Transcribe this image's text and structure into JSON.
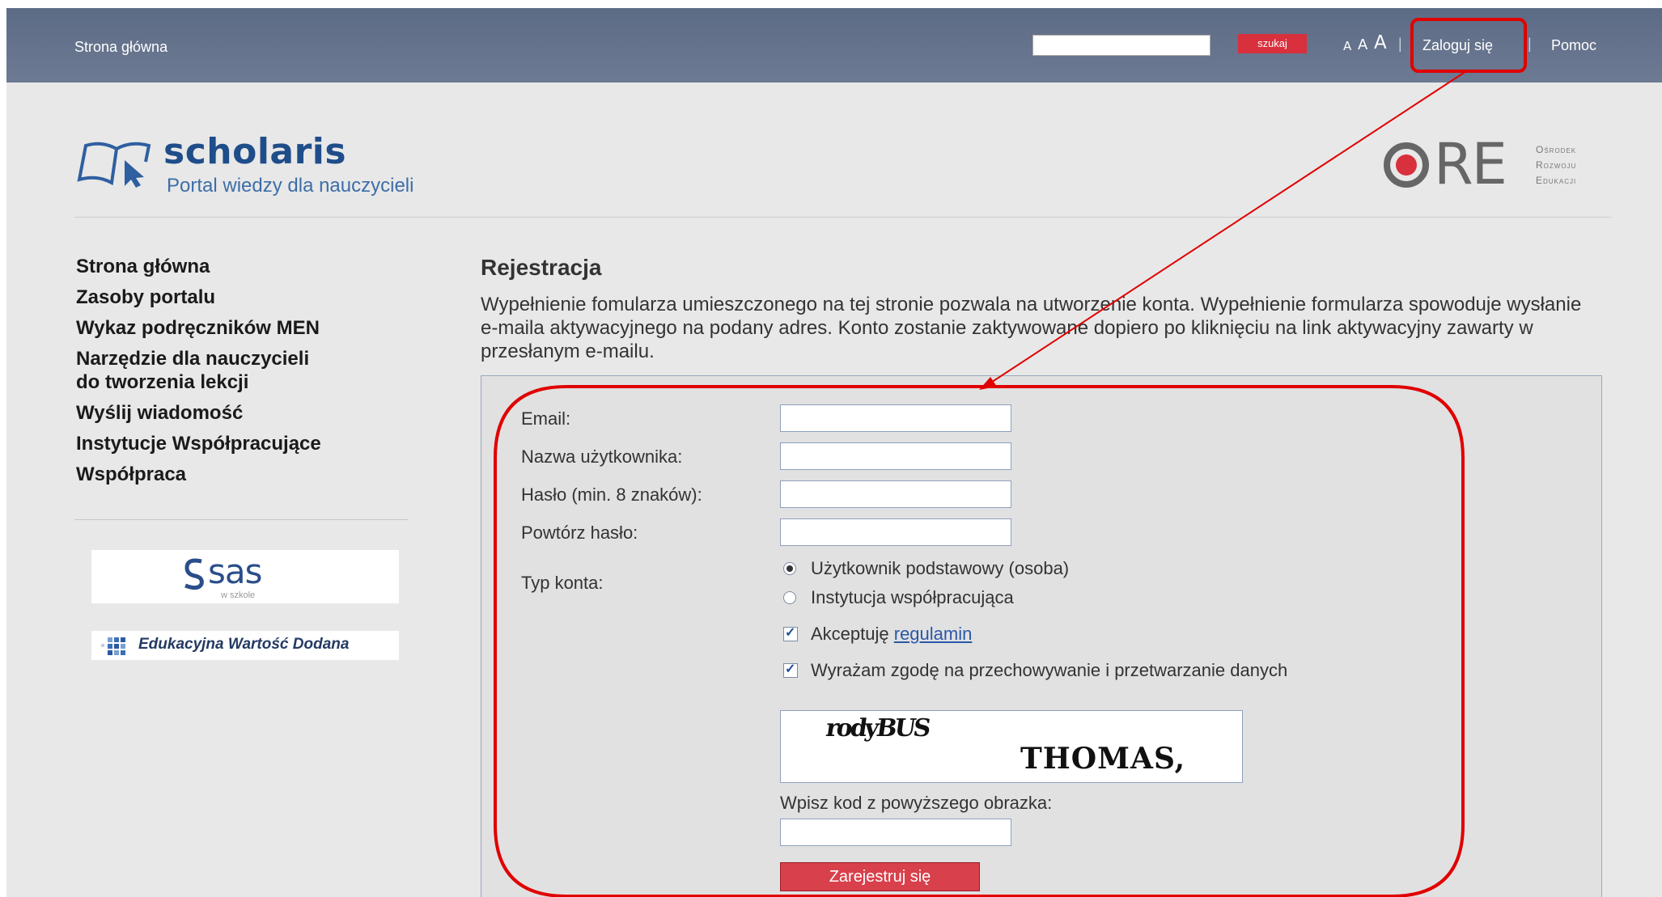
{
  "topbar": {
    "home": "Strona główna",
    "search_placeholder": "",
    "search_button": "szukaj",
    "font_small": "A",
    "font_medium": "A",
    "font_large": "A",
    "separator": "|",
    "login": "Zaloguj się",
    "help": "Pomoc"
  },
  "logo": {
    "name": "scholaris",
    "tagline": "Portal wiedzy dla nauczycieli"
  },
  "ore": {
    "mark": "RE",
    "line1": "Ośrodek",
    "line2": "Rozwoju",
    "line3": "Edukacji"
  },
  "sidebar": {
    "items": [
      {
        "label": "Strona główna"
      },
      {
        "label": "Zasoby portalu"
      },
      {
        "label": "Wykaz podręczników MEN"
      },
      {
        "label": "Narzędzie dla nauczycieli"
      },
      {
        "label": "do tworzenia lekcji"
      },
      {
        "label": "Wyślij wiadomość"
      },
      {
        "label": "Instytucje Współpracujące"
      },
      {
        "label": "Współpraca"
      }
    ],
    "sas": {
      "name": "sas",
      "sub": "w szkole"
    },
    "ewd": "Edukacyjna Wartość Dodana"
  },
  "main": {
    "title": "Rejestracja",
    "intro": "Wypełnienie fomularza umieszczonego na tej stronie pozwala na utworzenie konta. Wypełnienie formularza spowoduje wysłanie e-maila aktywacyjnego na podany adres. Konto zostanie zaktywowane dopiero po kliknięciu na link aktywacyjny zawarty w przesłanym e-mailu."
  },
  "form": {
    "email_label": "Email:",
    "email_value": "",
    "username_label": "Nazwa użytkownika:",
    "username_value": "",
    "password_label": "Hasło (min. 8 znaków):",
    "password_value": "",
    "repeat_label": "Powtórz hasło:",
    "repeat_value": "",
    "account_type_label": "Typ konta:",
    "account_types": [
      {
        "label": "Użytkownik podstawowy (osoba)",
        "selected": true
      },
      {
        "label": "Instytucja współpracująca",
        "selected": false
      }
    ],
    "accept_text": "Akceptuję",
    "accept_link": "regulamin",
    "accept_checked": true,
    "consent_text": "Wyrażam zgodę na przechowywanie i przetwarzanie danych",
    "consent_checked": true,
    "captcha_word1": "rodyBUS",
    "captcha_word2": "THOMAS,",
    "captcha_label": "Wpisz kod z powyższego obrazka:",
    "captcha_value": "",
    "submit": "Zarejestruj się"
  },
  "colors": {
    "topbar": "#5c6b85",
    "accent_red": "#d8303c",
    "annotation": "#e00000",
    "logo_blue": "#1f4d8a"
  }
}
